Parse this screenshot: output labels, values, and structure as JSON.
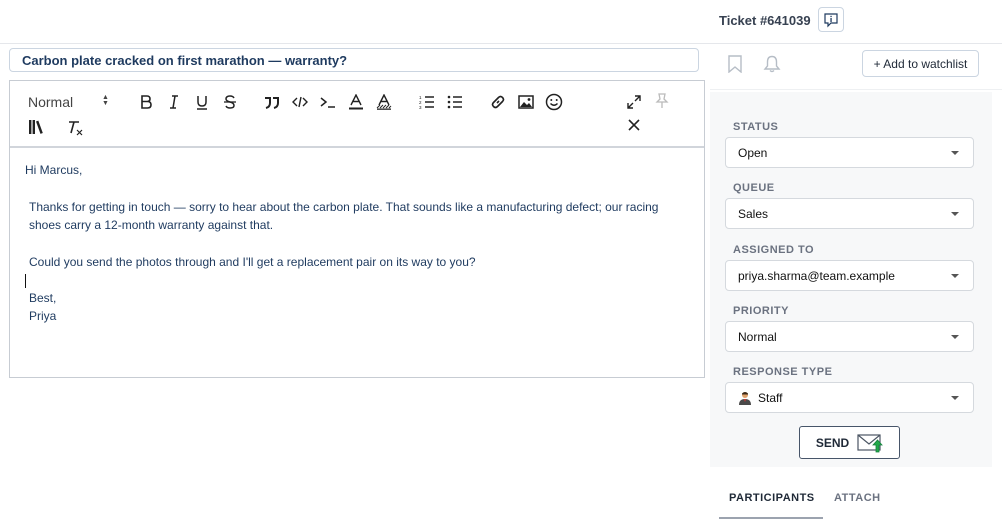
{
  "header": {
    "ticket_label": "Ticket #641039",
    "info_icon": "info-icon"
  },
  "subject": "Carbon plate cracked on first marathon — warranty?",
  "editor": {
    "format_select": "Normal",
    "toolbar_icons": [
      "bold-icon",
      "italic-icon",
      "underline-icon",
      "strikethrough-icon",
      "quote-icon",
      "code-icon",
      "code-block-icon",
      "font-color-icon",
      "background-color-icon",
      "ordered-list-icon",
      "bullet-list-icon",
      "link-icon",
      "image-icon",
      "emoji-icon",
      "expand-icon",
      "pin-icon",
      "library-icon",
      "clear-format-icon",
      "close-icon"
    ],
    "body": {
      "greeting": "Hi Marcus,",
      "para1": "Thanks for getting in touch — sorry to hear about the carbon plate. That sounds like a manufacturing defect; our racing shoes carry a 12-month warranty against that.",
      "para2": "Could you send the photos through and I'll get a replacement pair on its way to you?",
      "signoff": "Best,",
      "name": "Priya"
    }
  },
  "sidebar": {
    "watchlist_label": "+ Add to watchlist",
    "bookmark_icon": "bookmark-icon",
    "bell_icon": "bell-icon",
    "fields": {
      "status": {
        "label": "STATUS",
        "value": "Open"
      },
      "queue": {
        "label": "QUEUE",
        "value": "Sales"
      },
      "assigned": {
        "label": "ASSIGNED TO",
        "value": "priya.sharma@team.example"
      },
      "priority": {
        "label": "PRIORITY",
        "value": "Normal"
      },
      "response_type": {
        "label": "RESPONSE TYPE",
        "value": "Staff"
      }
    },
    "send_label": "SEND",
    "tabs": [
      "PARTICIPANTS",
      "ATTACH"
    ]
  }
}
